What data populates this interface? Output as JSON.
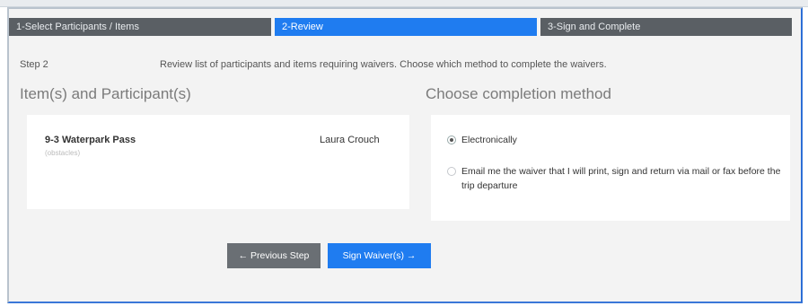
{
  "steps": [
    {
      "label": "1-Select Participants / Items",
      "state": "done"
    },
    {
      "label": "2-Review",
      "state": "active"
    },
    {
      "label": "3-Sign and Complete",
      "state": "upcoming"
    }
  ],
  "step_label": "Step 2",
  "step_description": "Review list of participants and items requiring waivers. Choose which method to complete the waivers.",
  "left_heading": "Item(s) and Participant(s)",
  "right_heading": "Choose completion method",
  "item": {
    "name": "9-3 Waterpark Pass",
    "sub": "(obstacles)",
    "participant": "Laura Crouch"
  },
  "options": [
    {
      "label": "Electronically",
      "checked": true
    },
    {
      "label": "Email me the waiver that I will print, sign and return via mail or fax before the trip departure",
      "checked": false
    }
  ],
  "buttons": {
    "previous": "← Previous Step",
    "sign": "Sign Waiver(s) →"
  },
  "colors": {
    "accent": "#1f7cf0",
    "step_dark": "#5a5f64",
    "button_secondary": "#6a6f74"
  }
}
